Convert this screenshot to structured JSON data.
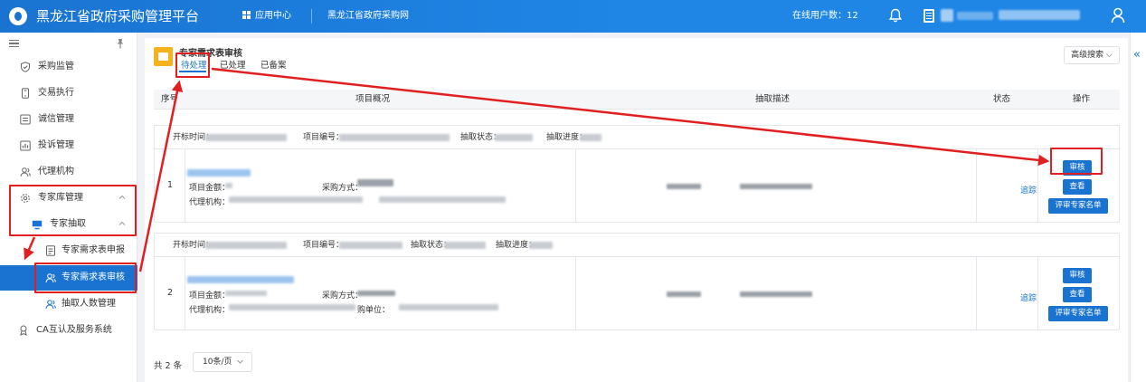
{
  "header": {
    "app_title": "黑龙江省政府采购管理平台",
    "app_center": "应用中心",
    "site_link": "黑龙江省政府采购网",
    "online_users_label": "在线用户数：",
    "online_users_count": "12",
    "icons": [
      "logo",
      "apps-grid-icon",
      "bell-icon",
      "document-icon",
      "user-icon"
    ]
  },
  "sidebar": {
    "items": [
      {
        "label": "采购监管",
        "icon": "shield-icon"
      },
      {
        "label": "交易执行",
        "icon": "phone-icon"
      },
      {
        "label": "诚信管理",
        "icon": "list-icon"
      },
      {
        "label": "投诉管理",
        "icon": "chart-icon"
      },
      {
        "label": "代理机构",
        "icon": "people-icon"
      },
      {
        "label": "专家库管理",
        "icon": "gear-icon",
        "expanded": true
      },
      {
        "label": "专家抽取",
        "icon": "monitor-icon",
        "expanded": true
      },
      {
        "label": "专家需求表申报",
        "icon": "form-icon"
      },
      {
        "label": "专家需求表审核",
        "icon": "people-icon",
        "active": true
      },
      {
        "label": "抽取人数管理",
        "icon": "people-icon"
      },
      {
        "label": "CA互认及服务系统",
        "icon": "ca-icon"
      }
    ]
  },
  "panel": {
    "title": "专家需求表审核",
    "tabs": [
      {
        "label": "待处理",
        "active": true
      },
      {
        "label": "已处理"
      },
      {
        "label": "已备案"
      }
    ],
    "advanced_search": "高级搜索"
  },
  "table": {
    "columns": [
      "序号",
      "项目概况",
      "抽取描述",
      "状态",
      "操作"
    ],
    "group_fields": {
      "open_time": "开标时间：",
      "project_no": "项目编号：",
      "extract_status": "抽取状态：",
      "extract_progress": "抽取进度："
    },
    "row_fields": {
      "amount": "项目金额：",
      "method": "采购方式：",
      "agency": "代理机构：",
      "buyer": "购单位："
    },
    "rows": [
      {
        "index": "1",
        "status": "追踪",
        "actions": [
          "审核",
          "查看",
          "评审专家名单"
        ]
      },
      {
        "index": "2",
        "status": "追踪",
        "actions": [
          "审核",
          "查看",
          "评审专家名单"
        ]
      }
    ]
  },
  "pagination": {
    "total": "共 2 条",
    "page_size": "10条/页"
  },
  "colors": {
    "primary": "#1a73d1",
    "annotation": "#e02020",
    "panel_icon": "#f6b21a"
  }
}
